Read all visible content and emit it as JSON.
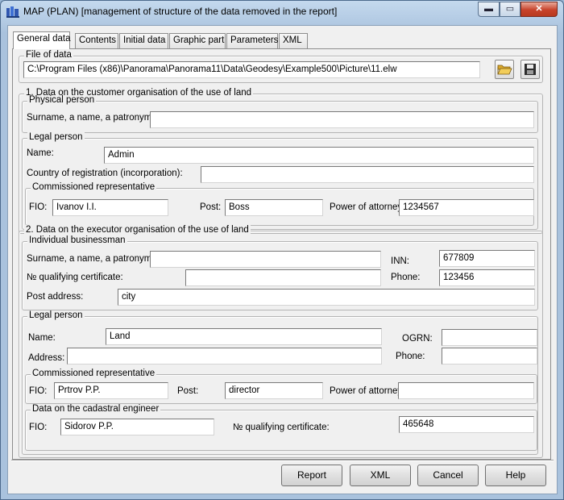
{
  "window": {
    "title": "MAP (PLAN) [management of structure of the data removed in the report]",
    "min_glyph": "▬",
    "max_glyph": "▭",
    "close_glyph": "✕"
  },
  "tabs": [
    "General data",
    "Contents",
    "Initial data",
    "Graphic part",
    "Parameters",
    "XML"
  ],
  "file_of_data": {
    "legend": "File of data",
    "path": "C:\\Program Files (x86)\\Panorama\\Panorama11\\Data\\Geodesy\\Example500\\Picture\\11.elw",
    "open_icon": "folder-open-icon",
    "save_icon": "floppy-disk-icon"
  },
  "customer": {
    "legend": "1. Data on the customer organisation of the use of land",
    "physical": {
      "legend": "Physical person",
      "name_label": "Surname, a name, a patronymic:",
      "name_value": ""
    },
    "legal": {
      "legend": "Legal person",
      "name_label": "Name:",
      "name_value": "Admin",
      "country_label": "Country of registration (incorporation):",
      "country_value": ""
    },
    "rep": {
      "legend": "Commissioned representative",
      "fio_label": "FIO:",
      "fio_value": "Ivanov I.I.",
      "post_label": "Post:",
      "post_value": "Boss",
      "poa_label": "Power of attorney:",
      "poa_value": "1234567"
    }
  },
  "executor": {
    "legend": "2. Data on the executor organisation of the use of land",
    "individual": {
      "legend": "Individual businessman",
      "name_label": "Surname, a name, a patronymic:",
      "name_value": "",
      "inn_label": "INN:",
      "inn_value": "677809",
      "cert_label": "№ qualifying certificate:",
      "cert_value": "",
      "phone_label": "Phone:",
      "phone_value": "123456",
      "address_label": "Post address:",
      "address_value": "city"
    },
    "legal": {
      "legend": "Legal person",
      "name_label": "Name:",
      "name_value": "Land",
      "ogrn_label": "OGRN:",
      "ogrn_value": "",
      "address_label": "Address:",
      "address_value": "",
      "phone_label": "Phone:",
      "phone_value": ""
    },
    "rep": {
      "legend": "Commissioned representative",
      "fio_label": "FIO:",
      "fio_value": "Prtrov P.P.",
      "post_label": "Post:",
      "post_value": "director",
      "poa_label": "Power of attorney",
      "poa_value": ""
    },
    "engineer": {
      "legend": "Data on the cadastral engineer",
      "fio_label": "FIO:",
      "fio_value": "Sidorov P.P.",
      "cert_label": "№ qualifying certificate:",
      "cert_value": "465648"
    }
  },
  "buttons": {
    "report": "Report",
    "xml": "XML",
    "cancel": "Cancel",
    "help": "Help"
  }
}
